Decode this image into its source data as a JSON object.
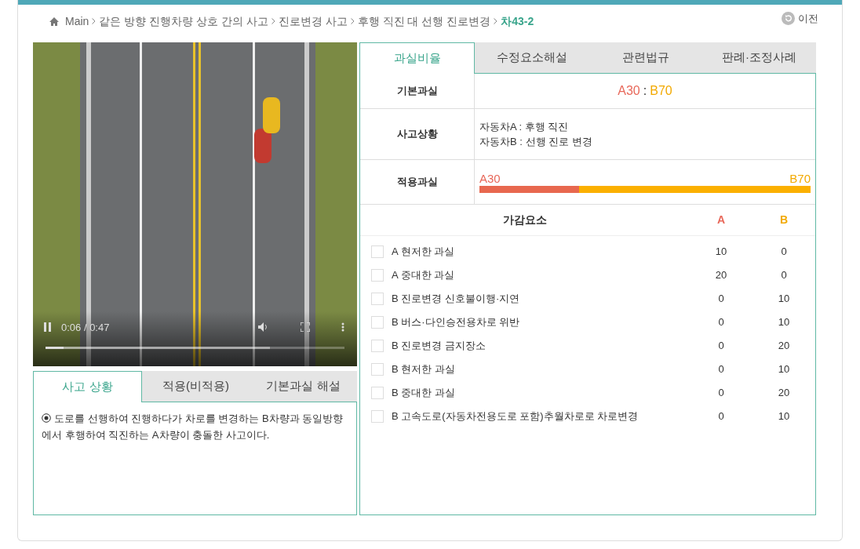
{
  "breadcrumb": {
    "items": [
      "Main",
      "같은 방향 진행차량 상호 간의 사고",
      "진로변경 사고",
      "후행 직진 대 선행 진로변경"
    ],
    "current": "차43-2"
  },
  "back_button": {
    "label": "이전"
  },
  "video": {
    "time": "0:06 / 0:47",
    "level": 0.06
  },
  "left_tabs": [
    {
      "label": "사고 상황",
      "selected": true
    },
    {
      "label": "적용(비적용)",
      "selected": false
    },
    {
      "label": "기본과실 해설",
      "selected": false
    }
  ],
  "description": "도로를 선행하여 진행하다가 차로를 변경하는 B차량과 동일방향에서 후행하여 직진하는 A차량이 충돌한 사고이다.",
  "right_tabs": [
    {
      "label": "과실비율",
      "selected": true
    },
    {
      "label": "수정요소해설",
      "selected": false
    },
    {
      "label": "관련법규",
      "selected": false
    },
    {
      "label": "판례·조정사례",
      "selected": false
    }
  ],
  "basic_fault": {
    "label": "기본과실",
    "a": "A30",
    "separator": ":",
    "b": "B70"
  },
  "situation": {
    "label": "사고상황",
    "lines": [
      "자동차A : 후행 직진",
      "자동차B : 선행 진로 변경"
    ]
  },
  "applied_fault": {
    "label": "적용과실",
    "a": "A30",
    "b": "B70",
    "level": 0.3
  },
  "factors": {
    "columns": [
      "가감요소",
      "A",
      "B"
    ],
    "rows": [
      {
        "label": "A 현저한 과실",
        "a": "10",
        "b": "0",
        "checked": false
      },
      {
        "label": "A 중대한 과실",
        "a": "20",
        "b": "0",
        "checked": false
      },
      {
        "label": "B 진로변경 신호불이행·지연",
        "a": "0",
        "b": "10",
        "checked": false
      },
      {
        "label": "B 버스·다인승전용차로 위반",
        "a": "0",
        "b": "10",
        "checked": false
      },
      {
        "label": "B 진로변경 금지장소",
        "a": "0",
        "b": "20",
        "checked": false
      },
      {
        "label": "B 현저한 과실",
        "a": "0",
        "b": "10",
        "checked": false
      },
      {
        "label": "B 중대한 과실",
        "a": "0",
        "b": "20",
        "checked": false
      },
      {
        "label": "B 고속도로(자동차전용도로 포함)추월차로로 차로변경",
        "a": "0",
        "b": "10",
        "checked": false
      }
    ]
  }
}
